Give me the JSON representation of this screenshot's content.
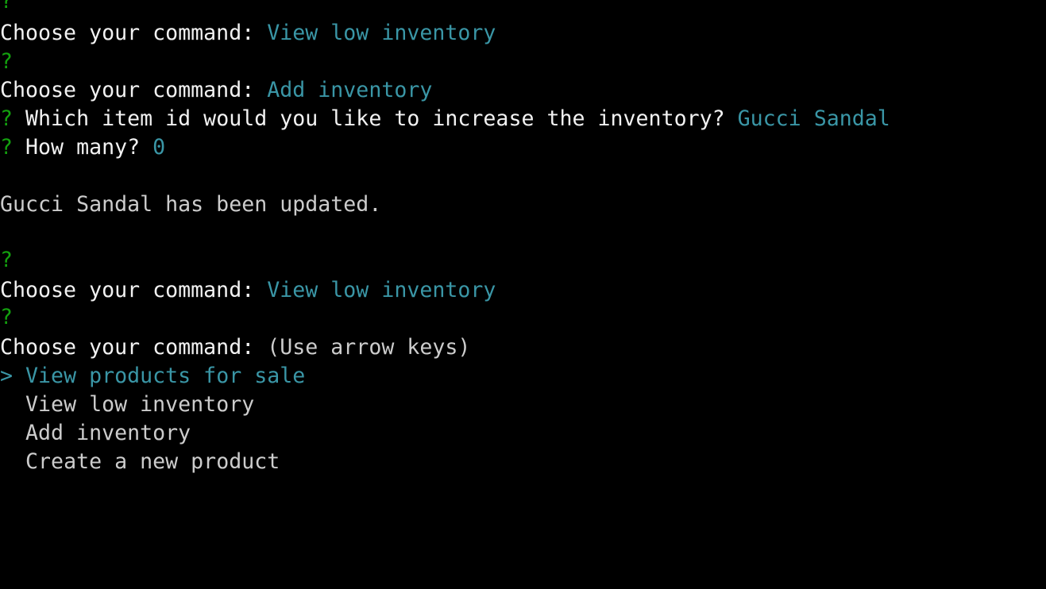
{
  "colors": {
    "background": "#000000",
    "question_mark": "#13a10e",
    "answer": "#3a96a6",
    "text": "#f2f2f2",
    "secondary_text": "#cccccc"
  },
  "terminal": {
    "question_glyph": "?",
    "pointer_glyph": ">",
    "prompt_command": "Choose your command: ",
    "answer_1": "View low inventory",
    "answer_2": "Add inventory",
    "prompt_item": "Which item id would you like to increase the inventory? ",
    "answer_item": "Gucci Sandal",
    "prompt_how_many": "How many? ",
    "answer_how_many": "0",
    "update_message": "Gucci Sandal has been updated.",
    "answer_3": "View low inventory",
    "hint": "(Use arrow keys)",
    "menu": {
      "selected": "View products for sale",
      "option_2": "View low inventory",
      "option_3": "Add inventory",
      "option_4": "Create a new product"
    }
  }
}
